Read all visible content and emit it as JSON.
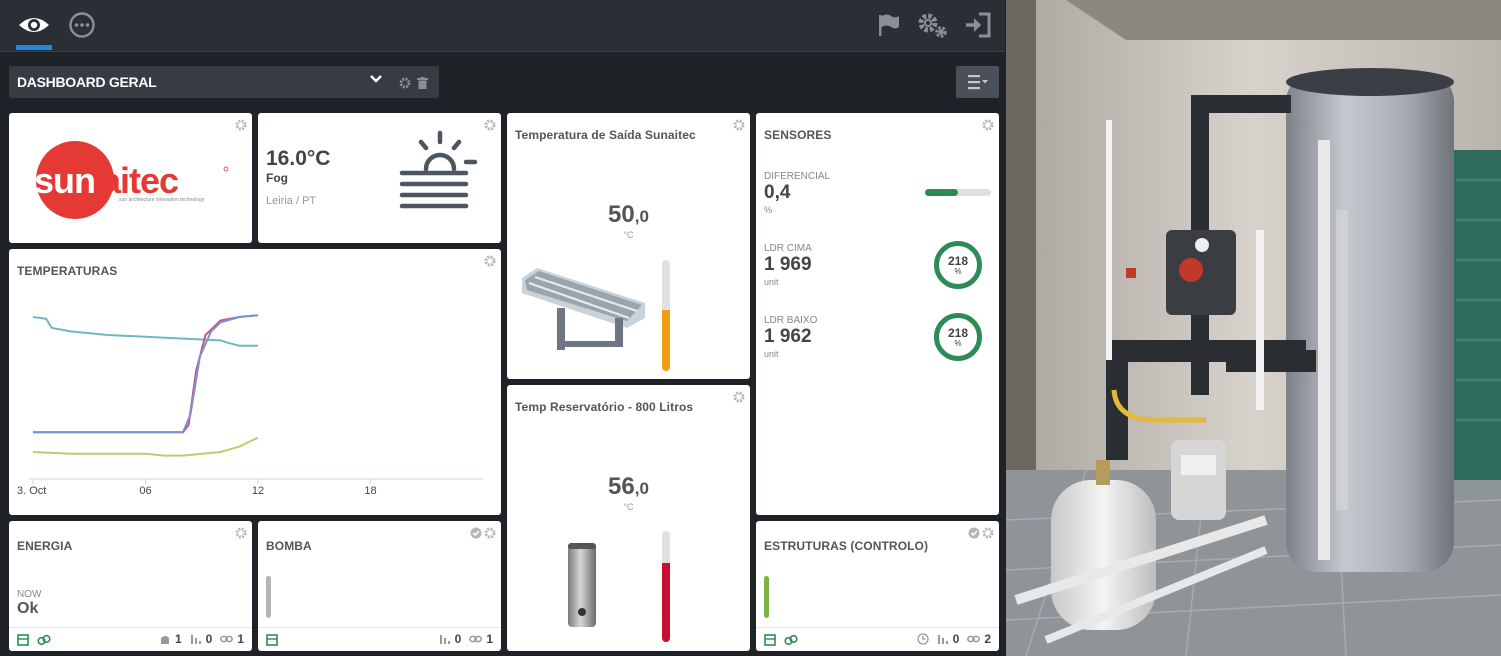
{
  "header": {
    "icons": [
      "eye-icon",
      "more-horizontal-icon",
      "flag-icon",
      "gears-icon",
      "sign-in-icon"
    ]
  },
  "dashboard": {
    "title": "DASHBOARD GERAL"
  },
  "widgets": {
    "logo": {
      "brand_text": "sunaitec",
      "tagline": "sun architecture innovation technology",
      "brand_color": "#e53935"
    },
    "weather": {
      "temp": "16.0°C",
      "condition": "Fog",
      "location": "Leiria / PT"
    },
    "temperaturas": {
      "title": "TEMPERATURAS"
    },
    "saida": {
      "title": "Temperatura de Saída Sunaitec",
      "value_int": "50",
      "value_dec": ",0",
      "unit": "°C",
      "level": 0.55,
      "bar_color": "#f39c12"
    },
    "reservatorio": {
      "title": "Temp Reservatório - 800 Litros",
      "value_int": "56",
      "value_dec": ",0",
      "unit": "°C",
      "level": 0.71,
      "bar_color": "#c8102e"
    },
    "sensores": {
      "title": "SENSORES",
      "diferencial": {
        "label": "DIFERENCIAL",
        "value": "0,4",
        "unit": "%",
        "level": 0.5
      },
      "ldr_cima": {
        "label": "LDR CIMA",
        "value": "1 969",
        "unit": "unit",
        "gauge": "218",
        "gauge_unit": "%"
      },
      "ldr_baixo": {
        "label": "LDR BAIXO",
        "value": "1 962",
        "unit": "unit",
        "gauge": "218",
        "gauge_unit": "%"
      }
    },
    "energia": {
      "title": "ENERGIA",
      "now_label": "NOW",
      "now_value": "Ok",
      "count_a": "1",
      "count_b": "0",
      "count_c": "1"
    },
    "bomba": {
      "title": "BOMBA",
      "count_b": "0",
      "count_c": "1"
    },
    "estruturas": {
      "title": "ESTRUTURAS (CONTROLO)",
      "count_b": "0",
      "count_c": "2"
    }
  },
  "chart_data": {
    "type": "line",
    "title": "",
    "xlabel": "",
    "ylabel": "",
    "x_ticks": [
      "3. Oct",
      "06",
      "12",
      "18"
    ],
    "x_range": [
      0,
      24
    ],
    "y_range": [
      0,
      100
    ],
    "grid": false,
    "series": [
      {
        "color": "#6fb8c0",
        "points": [
          [
            0,
            90
          ],
          [
            0.7,
            89
          ],
          [
            1,
            84
          ],
          [
            2,
            82
          ],
          [
            4,
            80
          ],
          [
            6,
            79
          ],
          [
            8,
            78
          ],
          [
            10,
            77
          ],
          [
            10.3,
            76
          ],
          [
            11,
            74
          ],
          [
            12,
            74
          ]
        ]
      },
      {
        "color": "#c8528a",
        "points": [
          [
            0,
            26
          ],
          [
            2,
            26
          ],
          [
            4,
            26
          ],
          [
            6,
            26
          ],
          [
            8,
            26
          ],
          [
            8.3,
            30
          ],
          [
            8.7,
            60
          ],
          [
            9.2,
            80
          ],
          [
            10,
            88
          ],
          [
            11,
            90
          ],
          [
            12,
            91
          ]
        ]
      },
      {
        "color": "#7a93c9",
        "points": [
          [
            0,
            26
          ],
          [
            2,
            26
          ],
          [
            4,
            26
          ],
          [
            6,
            26
          ],
          [
            8,
            26
          ],
          [
            8.4,
            36
          ],
          [
            8.9,
            68
          ],
          [
            9.5,
            82
          ],
          [
            10,
            87
          ],
          [
            11,
            90
          ],
          [
            12,
            91
          ]
        ]
      },
      {
        "color": "#b8d06a",
        "points": [
          [
            0,
            15
          ],
          [
            2,
            14
          ],
          [
            4,
            14
          ],
          [
            6,
            14
          ],
          [
            7,
            13
          ],
          [
            8,
            13
          ],
          [
            9,
            14
          ],
          [
            10,
            15
          ],
          [
            11,
            18
          ],
          [
            12,
            23
          ]
        ]
      }
    ]
  }
}
